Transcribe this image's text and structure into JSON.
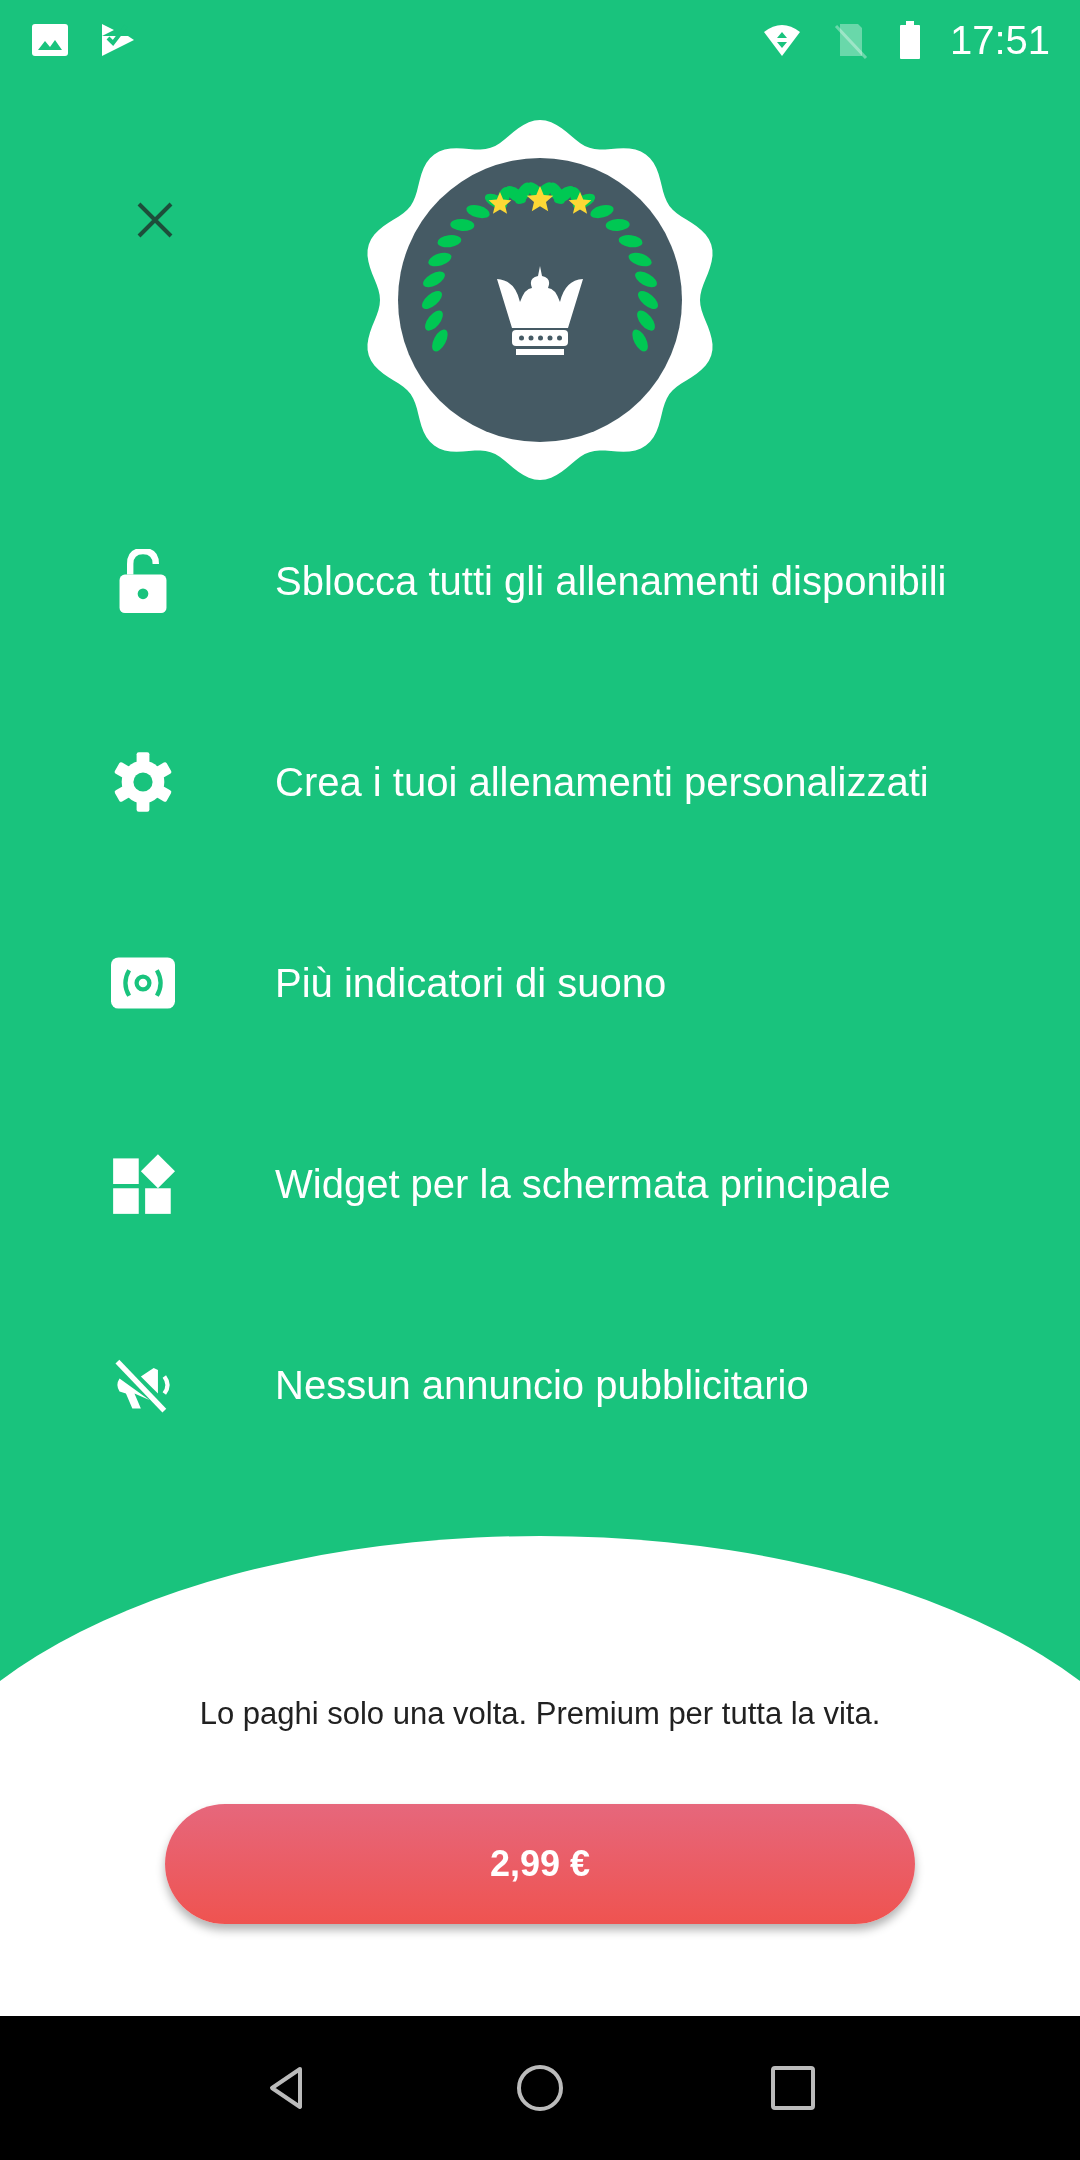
{
  "status_bar": {
    "time": "17:51"
  },
  "features": [
    {
      "kind": "lock",
      "text": "Sblocca tutti gli allenamenti disponibili"
    },
    {
      "kind": "gear",
      "text": "Crea i tuoi allenamenti personalizzati"
    },
    {
      "kind": "sound",
      "text": "Più indicatori di suono"
    },
    {
      "kind": "widget",
      "text": "Widget per la schermata principale"
    },
    {
      "kind": "noads",
      "text": "Nessun annuncio pubblicitario"
    }
  ],
  "footer": {
    "note": "Lo paghi solo una volta. Premium per tutta la vita.",
    "price_button": "2,99 €"
  }
}
